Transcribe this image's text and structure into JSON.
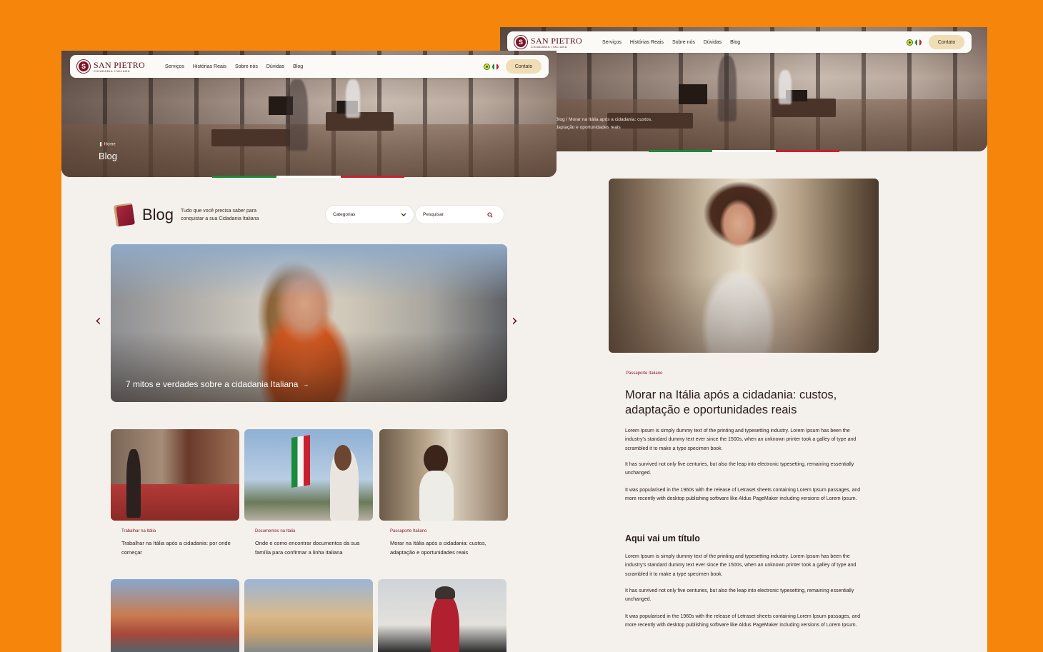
{
  "brand": {
    "name": "SAN PIETRO",
    "sub": "CIDADANIA ITALIANA",
    "logo_letter": "S"
  },
  "nav": {
    "items": [
      "Serviços",
      "Histórias Reais",
      "Sobre nós",
      "Dúvidas",
      "Blog"
    ],
    "contact_label": "Contato",
    "flags": [
      "brazil-flag",
      "italy-flag"
    ]
  },
  "blog_page": {
    "breadcrumb": "Home",
    "hero_title": "Blog",
    "heading": "Blog",
    "tagline_line1": "Tudo que você precisa saber para",
    "tagline_line2": "conquistar a sua Cidadania Italiana",
    "categories_label": "Categorias",
    "search_placeholder": "Pesquisar",
    "featured": {
      "title": "7 mitos e verdades sobre a cidadania Italiana",
      "arrow": "→"
    },
    "prev_arrow": "‹",
    "next_arrow": "›",
    "posts": [
      {
        "category": "Trabalhar na Itália",
        "title": "Trabalhar na Itália após a cidadania: por onde começar"
      },
      {
        "category": "Documentos na Italia",
        "title": "Onde e como encontrar documentos da sua família para confirmar a linha italiana"
      },
      {
        "category": "Passaporte Italiano",
        "title": "Morar na Itália após a cidadania: custos, adaptação e oportunidades reais"
      }
    ]
  },
  "article_page": {
    "breadcrumb_line1": "/ Blog / Morar na Itália após a cidadania: custos,",
    "breadcrumb_line2": "adaptação e oportunidades reais",
    "category": "Passaporte Italiano",
    "title": "Morar na Itália após a cidadania: custos, adaptação e oportunidades reais",
    "paragraphs": [
      "Lorem Ipsum is simply dummy text of the printing and typesetting industry. Lorem Ipsum has been the industry's standard dummy text ever since the 1500s, when an unknown printer took a galley of type and scrambled it to make a type specimen book.",
      "It has survived not only five centuries, but also the leap into electronic typesetting, remaining essentially unchanged.",
      "It was popularised in the 1960s with the release of Letraset sheets containing Lorem Ipsum passages, and more recently with desktop publishing software like Aldus PageMaker including versions of Lorem Ipsum."
    ],
    "subheading": "Aqui vai um título",
    "paragraphs2": [
      "Lorem Ipsum is simply dummy text of the printing and typesetting industry. Lorem Ipsum has been the industry's standard dummy text ever since the 1500s, when an unknown printer took a galley of type and scrambled it to make a type specimen book.",
      "It has survived not only five centuries, but also the leap into electronic typesetting, remaining essentially unchanged.",
      "It was popularised in the 1960s with the release of Letraset sheets containing Lorem Ipsum passages, and more recently with desktop publishing software like Aldus PageMaker including versions of Lorem Ipsum."
    ]
  },
  "colors": {
    "background": "#F5850B",
    "page": "#F4F1EC",
    "brand": "#7A1426",
    "contact_button": "#EFDDB5",
    "italy_green": "#1B8A3A",
    "italy_red": "#C8202F"
  }
}
